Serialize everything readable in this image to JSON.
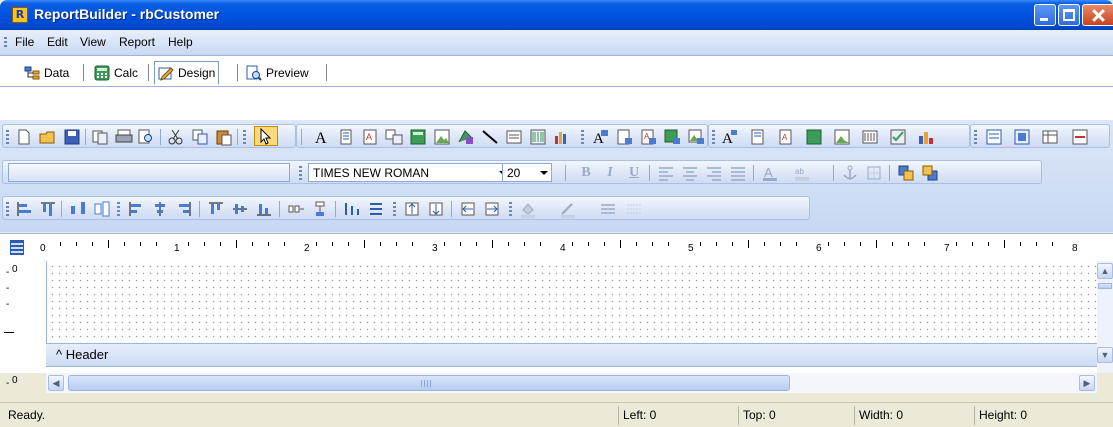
{
  "window": {
    "title": "ReportBuilder - rbCustomer",
    "app_icon_glyph": "R"
  },
  "menu": {
    "items": [
      "File",
      "Edit",
      "View",
      "Report",
      "Help"
    ]
  },
  "tabs": [
    {
      "label": "Data",
      "icon": "data-tree-icon"
    },
    {
      "label": "Calc",
      "icon": "calc-icon"
    },
    {
      "label": "Design",
      "icon": "design-icon",
      "selected": true
    },
    {
      "label": "Preview",
      "icon": "preview-icon"
    }
  ],
  "format": {
    "font_name": "TIMES NEW ROMAN",
    "font_size": "20"
  },
  "ruler": {
    "labels": [
      "0",
      "1",
      "2",
      "3",
      "4",
      "5",
      "6",
      "7",
      "8"
    ]
  },
  "vruler": {
    "labels": [
      "0",
      "0"
    ]
  },
  "band": {
    "header_label": "^ Header"
  },
  "status": {
    "ready": "Ready.",
    "left": "Left: 0",
    "top": "Top: 0",
    "width": "Width: 0",
    "height": "Height: 0"
  },
  "colors": {
    "titlebar": "#0052E0",
    "menubar": "#C9D9F4",
    "band": "#CDDCF4",
    "statusbar": "#ECE9D8"
  }
}
